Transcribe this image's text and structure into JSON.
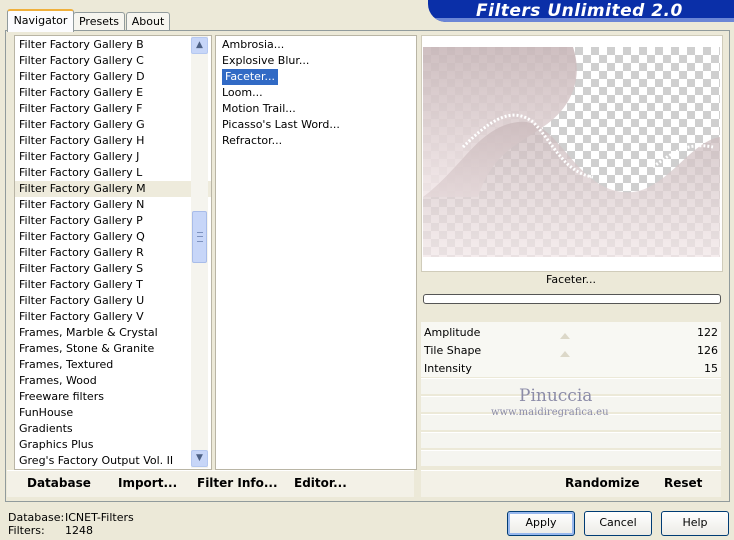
{
  "title": "Filters Unlimited 2.0",
  "tabs": [
    {
      "label": "Navigator"
    },
    {
      "label": "Presets"
    },
    {
      "label": "About"
    }
  ],
  "categories": [
    "Filter Factory Gallery B",
    "Filter Factory Gallery C",
    "Filter Factory Gallery D",
    "Filter Factory Gallery E",
    "Filter Factory Gallery F",
    "Filter Factory Gallery G",
    "Filter Factory Gallery H",
    "Filter Factory Gallery J",
    "Filter Factory Gallery L",
    "Filter Factory Gallery M",
    "Filter Factory Gallery N",
    "Filter Factory Gallery P",
    "Filter Factory Gallery Q",
    "Filter Factory Gallery R",
    "Filter Factory Gallery S",
    "Filter Factory Gallery T",
    "Filter Factory Gallery U",
    "Filter Factory Gallery V",
    "Frames, Marble & Crystal",
    "Frames, Stone & Granite",
    "Frames, Textured",
    "Frames, Wood",
    "Freeware filters",
    "FunHouse",
    "Gradients",
    "Graphics Plus",
    "Greg's Factory Output Vol. II"
  ],
  "filters": [
    "Ambrosia...",
    "Explosive Blur...",
    "Faceter...",
    "Loom...",
    "Motion Trail...",
    "Picasso's Last Word...",
    "Refractor..."
  ],
  "current_filter": "Faceter...",
  "params": [
    {
      "name": "Amplitude",
      "value": "122"
    },
    {
      "name": "Tile Shape",
      "value": "126"
    },
    {
      "name": "Intensity",
      "value": "15"
    }
  ],
  "watermark": {
    "name": "Pinuccia",
    "url": "www.maidiregrafica.eu"
  },
  "bottom_links": {
    "database": "Database",
    "import": "Import...",
    "filter_info": "Filter Info...",
    "editor": "Editor...",
    "randomize": "Randomize",
    "reset": "Reset"
  },
  "status": {
    "database_label": "Database:",
    "database_value": "ICNET-Filters",
    "filters_label": "Filters:",
    "filters_value": "1248"
  },
  "buttons": {
    "apply": "Apply",
    "cancel": "Cancel",
    "help": "Help"
  },
  "colors": {
    "banner": "#0A2FA8",
    "selection": "#316AC5",
    "tab_accent": "#F0B03C"
  }
}
